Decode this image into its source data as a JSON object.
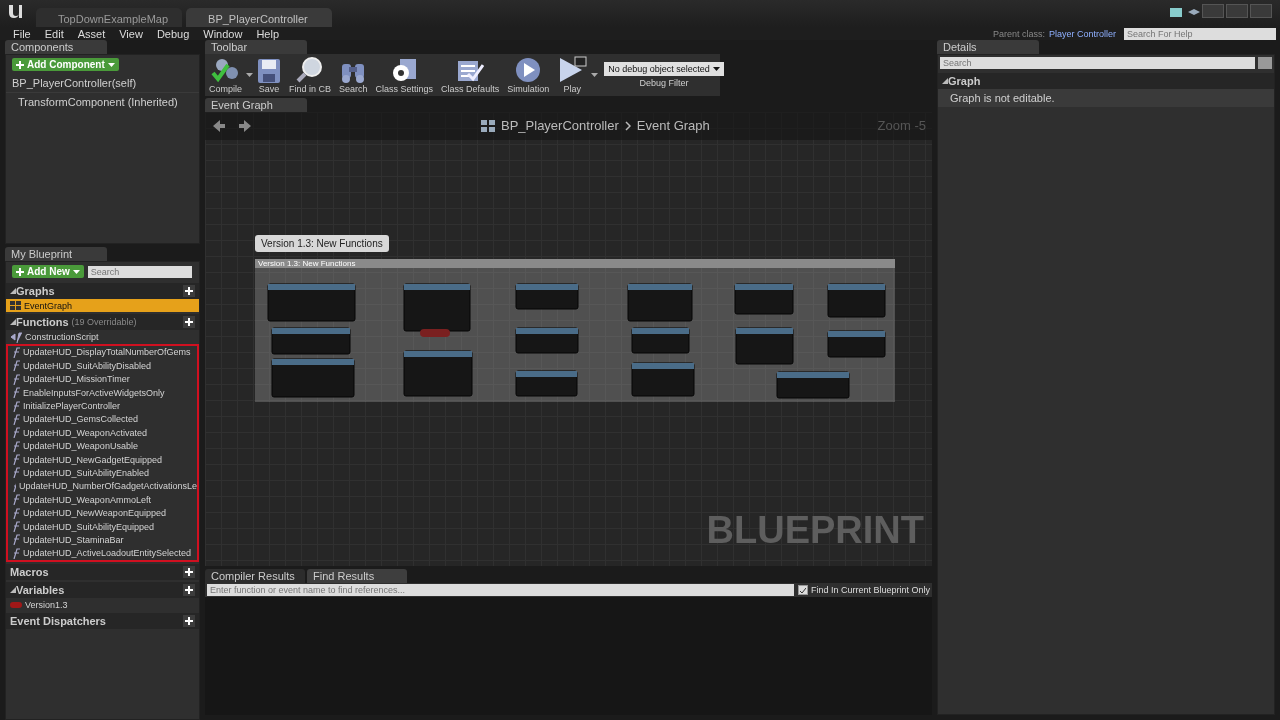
{
  "app_tabs": [
    {
      "label": "TopDownExampleMap",
      "selected": false
    },
    {
      "label": "BP_PlayerController",
      "selected": true
    }
  ],
  "menu": [
    "File",
    "Edit",
    "Asset",
    "View",
    "Debug",
    "Window",
    "Help"
  ],
  "parent_class": {
    "label": "Parent class:",
    "value": "Player Controller"
  },
  "help_search": {
    "placeholder": "Search For Help"
  },
  "components": {
    "tab": "Components",
    "add_button": "Add Component",
    "items": [
      {
        "label": "BP_PlayerController(self)",
        "children": [
          {
            "label": "TransformComponent (Inherited)"
          }
        ]
      }
    ]
  },
  "my_blueprint": {
    "tab": "My Blueprint",
    "add_button": "Add New",
    "search": {
      "placeholder": "Search"
    },
    "sections": [
      {
        "title": "Graphs",
        "expanded": true,
        "items": [
          {
            "label": "EventGraph",
            "kind": "graph",
            "selected": true,
            "highlighted": false
          }
        ]
      },
      {
        "title": "Functions",
        "note": "(19 Overridable)",
        "expanded": true,
        "items": [
          {
            "label": "ConstructionScript",
            "kind": "construction",
            "selected": false,
            "highlighted": false
          },
          {
            "label": "UpdateHUD_DisplayTotalNumberOfGems",
            "kind": "function",
            "selected": false,
            "highlighted": true
          },
          {
            "label": "UpdateHUD_SuitAbilityDisabled",
            "kind": "function",
            "selected": false,
            "highlighted": true
          },
          {
            "label": "UpdateHUD_MissionTimer",
            "kind": "function",
            "selected": false,
            "highlighted": true
          },
          {
            "label": "EnableInputsForActiveWidgetsOnly",
            "kind": "function",
            "selected": false,
            "highlighted": true
          },
          {
            "label": "InitializePlayerController",
            "kind": "function",
            "selected": false,
            "highlighted": true
          },
          {
            "label": "UpdateHUD_GemsCollected",
            "kind": "function",
            "selected": false,
            "highlighted": true
          },
          {
            "label": "UpdateHUD_WeaponActivated",
            "kind": "function",
            "selected": false,
            "highlighted": true
          },
          {
            "label": "UpdateHUD_WeaponUsable",
            "kind": "function",
            "selected": false,
            "highlighted": true
          },
          {
            "label": "UpdateHUD_NewGadgetEquipped",
            "kind": "function",
            "selected": false,
            "highlighted": true
          },
          {
            "label": "UpdateHUD_SuitAbilityEnabled",
            "kind": "function",
            "selected": false,
            "highlighted": true
          },
          {
            "label": "UpdateHUD_NumberOfGadgetActivationsLe",
            "kind": "function",
            "selected": false,
            "highlighted": true
          },
          {
            "label": "UpdateHUD_WeaponAmmoLeft",
            "kind": "function",
            "selected": false,
            "highlighted": true
          },
          {
            "label": "UpdateHUD_NewWeaponEquipped",
            "kind": "function",
            "selected": false,
            "highlighted": true
          },
          {
            "label": "UpdateHUD_SuitAbilityEquipped",
            "kind": "function",
            "selected": false,
            "highlighted": true
          },
          {
            "label": "UpdateHUD_StaminaBar",
            "kind": "function",
            "selected": false,
            "highlighted": true
          },
          {
            "label": "UpdateHUD_ActiveLoadoutEntitySelected",
            "kind": "function",
            "selected": false,
            "highlighted": true
          }
        ]
      },
      {
        "title": "Macros",
        "expanded": false
      },
      {
        "title": "Variables",
        "expanded": true,
        "items": [
          {
            "label": "Version1.3",
            "kind": "variable",
            "selected": false,
            "highlighted": false
          }
        ]
      },
      {
        "title": "Event Dispatchers",
        "expanded": false
      }
    ]
  },
  "toolbar": {
    "tab": "Toolbar",
    "buttons": [
      {
        "label": "Compile",
        "kind": "compile",
        "dropdown": true
      },
      {
        "label": "Save",
        "kind": "save",
        "dropdown": false
      },
      {
        "label": "Find in CB",
        "kind": "find",
        "dropdown": false
      },
      {
        "label": "Search",
        "kind": "search",
        "dropdown": false
      },
      {
        "label": "Class Settings",
        "kind": "settings",
        "dropdown": false
      },
      {
        "label": "Class Defaults",
        "kind": "defaults",
        "dropdown": false
      },
      {
        "label": "Simulation",
        "kind": "simulation",
        "dropdown": false
      },
      {
        "label": "Play",
        "kind": "play",
        "dropdown": true
      }
    ],
    "debug_filter": {
      "value": "No debug object selected",
      "label": "Debug Filter"
    }
  },
  "graph": {
    "tab": "Event Graph",
    "breadcrumb": [
      "BP_PlayerController",
      "Event Graph"
    ],
    "zoom": "Zoom -5",
    "comment_bubble": "Version 1.3: New Functions",
    "comment_title": "Version 1.3: New Functions",
    "watermark": "BLUEPRINT"
  },
  "bottom": {
    "tabs": [
      {
        "label": "Compiler Results",
        "selected": false
      },
      {
        "label": "Find Results",
        "selected": true
      }
    ],
    "search": {
      "placeholder": "Enter function or event name to find references..."
    },
    "checkbox": {
      "label": "Find In Current Blueprint Only",
      "checked": true
    }
  },
  "details": {
    "tab": "Details",
    "search": {
      "placeholder": "Search"
    },
    "section": "Graph",
    "message": "Graph is not editable."
  }
}
